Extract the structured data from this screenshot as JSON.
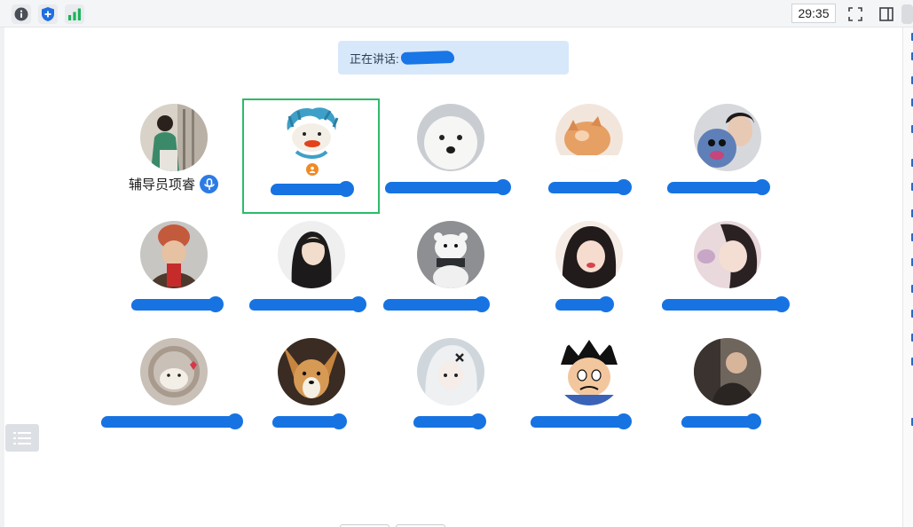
{
  "toolbar": {
    "timer": "29:35",
    "icons": [
      "info-icon",
      "shield-icon",
      "signal-bars-icon",
      "fullscreen-icon",
      "side-panel-icon"
    ]
  },
  "speaking_banner": {
    "label": "正在讲话:"
  },
  "participants": [
    {
      "name": "辅导员项睿",
      "has_mic_badge": true
    },
    {
      "name": "",
      "active": true
    },
    {
      "name": ""
    },
    {
      "name": ""
    },
    {
      "name": ""
    },
    {
      "name": ""
    },
    {
      "name": ""
    },
    {
      "name": ""
    },
    {
      "name": ""
    },
    {
      "name": ""
    },
    {
      "name": ""
    },
    {
      "name": ""
    },
    {
      "name": ""
    },
    {
      "name": ""
    },
    {
      "name": ""
    }
  ],
  "colors": {
    "active_border": "#2dbb6a",
    "speaking_bg": "#d8e8fb",
    "mic_badge": "#2c7be5",
    "redaction": "#1773e2"
  }
}
